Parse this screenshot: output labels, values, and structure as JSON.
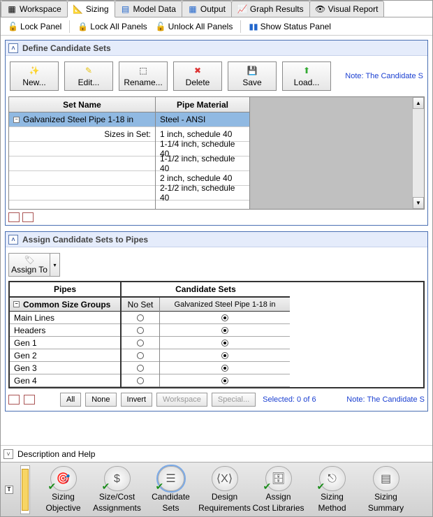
{
  "tabs": [
    {
      "label": "Workspace",
      "icon": "workspace-icon"
    },
    {
      "label": "Sizing",
      "icon": "sizing-icon"
    },
    {
      "label": "Model Data",
      "icon": "model-data-icon"
    },
    {
      "label": "Output",
      "icon": "output-icon"
    },
    {
      "label": "Graph Results",
      "icon": "graph-icon"
    },
    {
      "label": "Visual Report",
      "icon": "eye-icon"
    }
  ],
  "active_tab": 1,
  "lockbar": {
    "lock_panel": "Lock Panel",
    "lock_all": "Lock All Panels",
    "unlock_all": "Unlock All Panels",
    "show_status": "Show Status Panel"
  },
  "define_panel": {
    "title": "Define Candidate Sets",
    "buttons": {
      "new": "New...",
      "edit": "Edit...",
      "rename": "Rename...",
      "delete": "Delete",
      "save": "Save",
      "load": "Load..."
    },
    "note": "Note: The Candidate S",
    "headers": {
      "set_name": "Set Name",
      "pipe_material": "Pipe Material"
    },
    "set_row": {
      "name": "Galvanized Steel Pipe 1-18 in",
      "material": "Steel - ANSI"
    },
    "sizes_label": "Sizes in Set:",
    "sizes": [
      "1 inch, schedule 40",
      "1-1/4 inch, schedule 40",
      "1-1/2 inch, schedule 40",
      "2 inch, schedule 40",
      "2-1/2 inch, schedule 40"
    ]
  },
  "assign_panel": {
    "title": "Assign Candidate Sets to Pipes",
    "assign_to": "Assign To",
    "headers": {
      "pipes": "Pipes",
      "candidate_sets": "Candidate Sets",
      "no_set": "No Set",
      "galv": "Galvanized Steel Pipe 1-18 in"
    },
    "group_header": "Common Size Groups",
    "rows": [
      {
        "name": "Main Lines",
        "sel": "galv"
      },
      {
        "name": "Headers",
        "sel": "galv"
      },
      {
        "name": "Gen 1",
        "sel": "galv"
      },
      {
        "name": "Gen 2",
        "sel": "galv"
      },
      {
        "name": "Gen 3",
        "sel": "galv"
      },
      {
        "name": "Gen 4",
        "sel": "galv"
      }
    ],
    "selbar": {
      "all": "All",
      "none": "None",
      "invert": "Invert",
      "workspace": "Workspace",
      "special": "Special...",
      "selected": "Selected: 0 of 6"
    },
    "note": "Note: The Candidate S"
  },
  "desc_help": "Description and Help",
  "bottom_nav": [
    {
      "l1": "Sizing",
      "l2": "Objective",
      "icon": "target",
      "chk": true
    },
    {
      "l1": "Size/Cost",
      "l2": "Assignments",
      "icon": "dollar",
      "chk": true
    },
    {
      "l1": "Candidate",
      "l2": "Sets",
      "icon": "list",
      "chk": true,
      "active": true
    },
    {
      "l1": "Design",
      "l2": "Requirements",
      "icon": "var",
      "chk": false
    },
    {
      "l1": "Assign",
      "l2": "Cost Libraries",
      "icon": "db",
      "chk": true
    },
    {
      "l1": "Sizing",
      "l2": "Method",
      "icon": "flow",
      "chk": true
    },
    {
      "l1": "Sizing",
      "l2": "Summary",
      "icon": "doc",
      "chk": false
    }
  ]
}
